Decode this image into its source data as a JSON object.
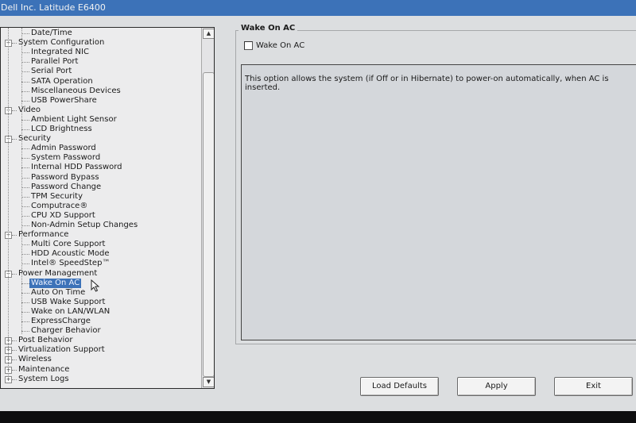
{
  "window": {
    "title": "Dell Inc. Latitude E6400"
  },
  "tree": {
    "items": [
      {
        "label": "Date/Time",
        "level": 1
      },
      {
        "label": "System Configuration",
        "level": 0,
        "expander": "−"
      },
      {
        "label": "Integrated NIC",
        "level": 1
      },
      {
        "label": "Parallel Port",
        "level": 1
      },
      {
        "label": "Serial Port",
        "level": 1
      },
      {
        "label": "SATA Operation",
        "level": 1
      },
      {
        "label": "Miscellaneous Devices",
        "level": 1
      },
      {
        "label": "USB PowerShare",
        "level": 1
      },
      {
        "label": "Video",
        "level": 0,
        "expander": "−"
      },
      {
        "label": "Ambient Light Sensor",
        "level": 1
      },
      {
        "label": "LCD Brightness",
        "level": 1
      },
      {
        "label": "Security",
        "level": 0,
        "expander": "−"
      },
      {
        "label": "Admin Password",
        "level": 1
      },
      {
        "label": "System Password",
        "level": 1
      },
      {
        "label": "Internal HDD Password",
        "level": 1
      },
      {
        "label": "Password Bypass",
        "level": 1
      },
      {
        "label": "Password Change",
        "level": 1
      },
      {
        "label": "TPM Security",
        "level": 1
      },
      {
        "label": "Computrace®",
        "level": 1
      },
      {
        "label": "CPU XD Support",
        "level": 1
      },
      {
        "label": "Non-Admin Setup Changes",
        "level": 1
      },
      {
        "label": "Performance",
        "level": 0,
        "expander": "−"
      },
      {
        "label": "Multi Core Support",
        "level": 1
      },
      {
        "label": "HDD Acoustic Mode",
        "level": 1
      },
      {
        "label": "Intel® SpeedStep™",
        "level": 1
      },
      {
        "label": "Power Management",
        "level": 0,
        "expander": "−"
      },
      {
        "label": "Wake On AC",
        "level": 1,
        "selected": true
      },
      {
        "label": "Auto On Time",
        "level": 1
      },
      {
        "label": "USB Wake Support",
        "level": 1
      },
      {
        "label": "Wake on LAN/WLAN",
        "level": 1
      },
      {
        "label": "ExpressCharge",
        "level": 1
      },
      {
        "label": "Charger Behavior",
        "level": 1
      },
      {
        "label": "Post Behavior",
        "level": 0,
        "expander": "+"
      },
      {
        "label": "Virtualization Support",
        "level": 0,
        "expander": "+"
      },
      {
        "label": "Wireless",
        "level": 0,
        "expander": "+"
      },
      {
        "label": "Maintenance",
        "level": 0,
        "expander": "+"
      },
      {
        "label": "System Logs",
        "level": 0,
        "expander": "+"
      }
    ]
  },
  "scrollbar": {
    "up_icon": "scroll-up-arrow-icon",
    "down_icon": "scroll-down-arrow-icon"
  },
  "setting": {
    "group_title": "Wake On AC",
    "checkbox_label": "Wake On AC",
    "checked": false,
    "description": "This option allows the system (if Off or in Hibernate) to power-on automatically, when AC is inserted."
  },
  "buttons": {
    "load_defaults": "Load Defaults",
    "apply": "Apply",
    "exit": "Exit"
  },
  "colors": {
    "selection": "#3c72b8",
    "background": "#dcdee0",
    "tree_background": "#ececed"
  }
}
